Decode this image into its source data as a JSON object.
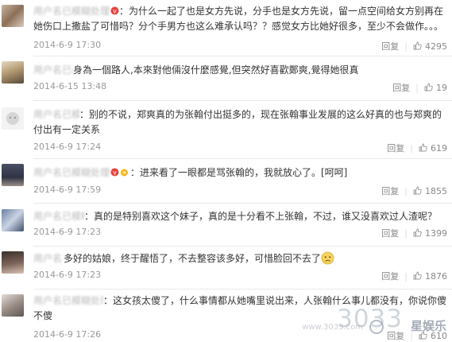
{
  "comments": [
    {
      "user": "用户名已模糊处理",
      "badge_color": "#e8413c",
      "text_parts": [
        "：为什么一起了也是女方先说，分手也是女方先说，留一点空间给女方别再在她伤口上撒盐了可惜吗？分个手男方也这么难承认吗？？感觉女方比她好很多，至少不会做作。。。"
      ],
      "time": "2014-6-9 17:30",
      "reply_label": "回复",
      "like_count": "4295"
    },
    {
      "user": "用户名已模糊处理",
      "text_parts": [
        "身為一個路人,本來對他倆沒什麼感覺,但突然好喜歡鄭爽,覺得她很真"
      ],
      "time": "2014-6-15 13:48",
      "reply_label": "回复",
      "like_count": "19"
    },
    {
      "user": "用户名已模糊处理",
      "text_parts": [
        "：别的不说，郑爽真的为张翰付出挺多的，现在张翰事业发展的这么好真的也与郑爽的付出有一定关系"
      ],
      "time": "2014-6-9 17:24",
      "reply_label": "回复",
      "like_count": "619"
    },
    {
      "user": "用户名已模糊处理",
      "badge_color": "#e8413c",
      "text_parts": [
        "：进来看了一眼都是骂张翰的，我就放心了。[呵呵]"
      ],
      "time": "2014-6-9 17:59",
      "reply_label": "回复",
      "like_count": "1855"
    },
    {
      "user": "用户名已模糊处理",
      "text_parts": [
        "：真的是特别喜欢这个妹子，真的是十分看不上张翰，不过，谁又没喜欢过人渣呢？"
      ],
      "time": "2014-6-9 17:23",
      "reply_label": "回复",
      "like_count": "1399"
    },
    {
      "user": "用户名已模糊处理",
      "text_parts": [
        "多好的姑娘，终于醒悟了，不去整容该多好，可惜脸回不去了"
      ],
      "time": "2014-6-9 17:23",
      "reply_label": "回复",
      "like_count": "1876"
    },
    {
      "user": "用户名已模糊处理",
      "text_parts": [
        "：这女孩太傻了，什么事情都从她嘴里说出来，人张翰什么事儿都没有，你说你傻不傻"
      ],
      "time": "2014-6-9 17:26",
      "reply_label": "回复",
      "like_count": "610"
    }
  ],
  "watermark": {
    "number": "3033",
    "badge": "星娱乐",
    "url": "www.3033.com"
  },
  "colors": {
    "text": "#333333",
    "meta": "#999999",
    "divider": "#e9e9e9",
    "link": "#eb7350"
  }
}
